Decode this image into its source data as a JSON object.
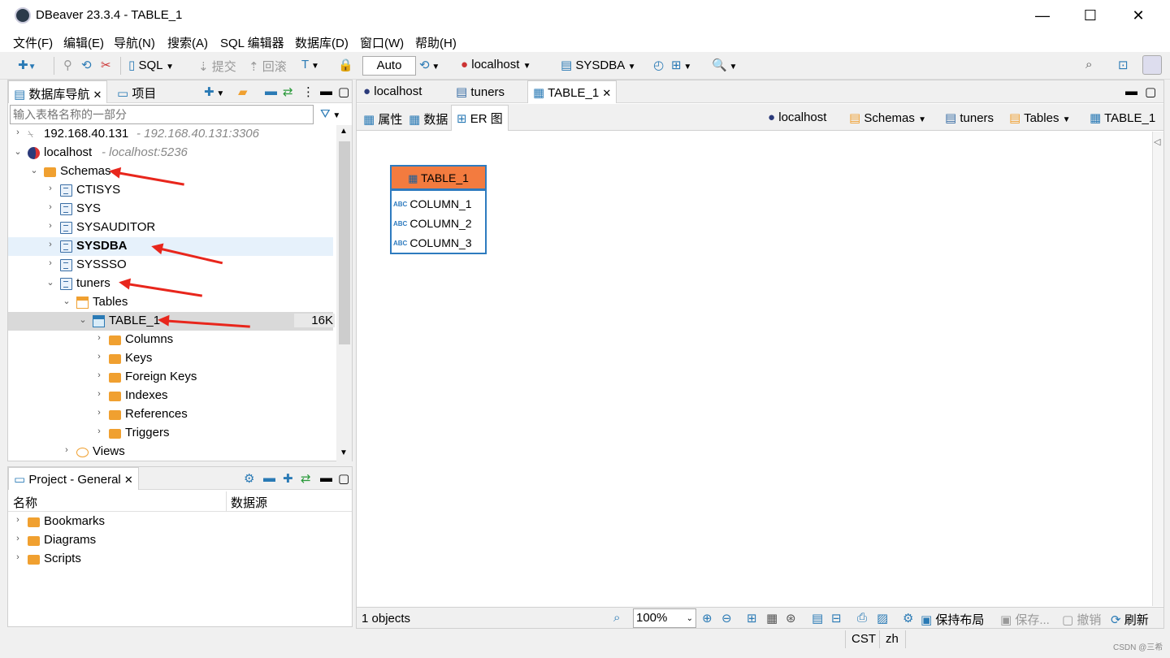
{
  "window": {
    "title": "DBeaver 23.3.4 - TABLE_1",
    "minimize": "—",
    "maximize": "☐",
    "close": "✕"
  },
  "menu": [
    "文件(F)",
    "编辑(E)",
    "导航(N)",
    "搜索(A)",
    "SQL 编辑器",
    "数据库(D)",
    "窗口(W)",
    "帮助(H)"
  ],
  "toolbar": {
    "sql": "SQL",
    "commit": "提交",
    "rollback": "回滚",
    "transaction_mode": "Auto",
    "connection": "localhost",
    "schema": "SYSDBA"
  },
  "navigator": {
    "tab_label": "数据库导航",
    "project_tab_label": "项目",
    "filter_placeholder": "输入表格名称的一部分",
    "tree": [
      {
        "label": "192.168.40.131",
        "detail": " - 192.168.40.131:3306"
      },
      {
        "label": "localhost",
        "detail": " - localhost:5236"
      },
      {
        "label": "Schemas"
      },
      {
        "label": "CTISYS"
      },
      {
        "label": "SYS"
      },
      {
        "label": "SYSAUDITOR"
      },
      {
        "label": "SYSDBA"
      },
      {
        "label": "SYSSSO"
      },
      {
        "label": "tuners"
      },
      {
        "label": "Tables"
      },
      {
        "label": "TABLE_1",
        "size": "16K"
      },
      {
        "label": "Columns"
      },
      {
        "label": "Keys"
      },
      {
        "label": "Foreign Keys"
      },
      {
        "label": "Indexes"
      },
      {
        "label": "References"
      },
      {
        "label": "Triggers"
      },
      {
        "label": "Views"
      }
    ]
  },
  "project": {
    "tab_label": "Project - General",
    "col_name": "名称",
    "col_source": "数据源",
    "items": [
      "Bookmarks",
      "Diagrams",
      "Scripts"
    ]
  },
  "editor": {
    "tabs": [
      "localhost",
      "tuners",
      "TABLE_1"
    ],
    "subtabs": [
      "属性",
      "数据",
      "ER 图"
    ],
    "breadcrumb": [
      "localhost",
      "Schemas",
      "tuners",
      "Tables",
      "TABLE_1"
    ],
    "entity": {
      "name": "TABLE_1",
      "columns": [
        "COLUMN_1",
        "COLUMN_2",
        "COLUMN_3"
      ]
    },
    "status": {
      "objects": "1 objects",
      "zoom": "100%",
      "save_layout": "保持布局",
      "save": "保存...",
      "undo": "撤销",
      "refresh": "刷新"
    }
  },
  "statusbar": {
    "timezone": "CST",
    "locale": "zh",
    "watermark": "CSDN @三希"
  },
  "colors": {
    "entity_header": "#f37b3f",
    "entity_border": "#2e7bbf",
    "arrow": "#e8261c",
    "folder": "#f0a030"
  }
}
